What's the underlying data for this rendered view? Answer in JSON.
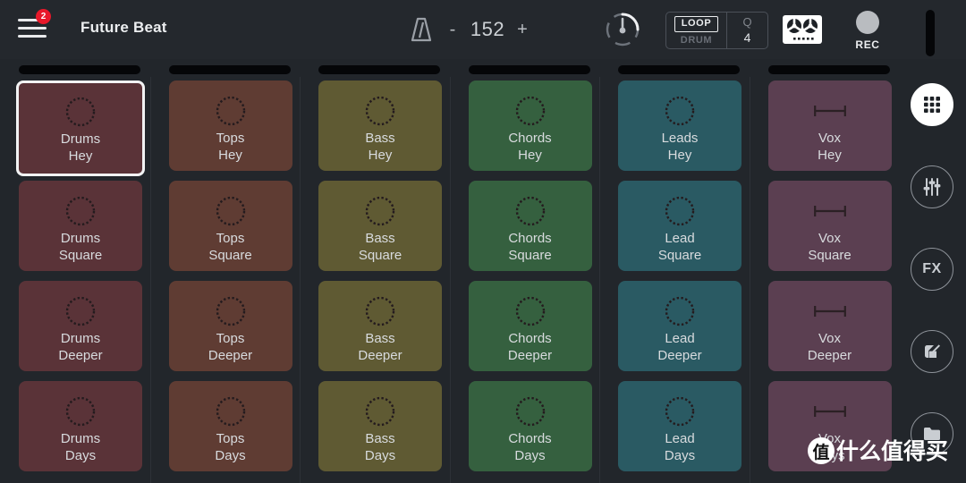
{
  "app": {
    "title": "Future Beat",
    "menu_badge": "2"
  },
  "header": {
    "metronome_icon": "metronome-icon",
    "tempo_decrease": "-",
    "tempo_value": "152",
    "tempo_increase": "+",
    "dial_icon": "dial-knob-icon",
    "loop_label": "LOOP",
    "drum_label": "DRUM",
    "quantize_label": "Q",
    "quantize_value": "4",
    "mixer_icon": "mixer-icon",
    "rec_label": "REC",
    "rec_icon": "record-dot-icon",
    "scrollbar": "vertical-scrollbar"
  },
  "rail": {
    "items": [
      {
        "name": "grid-view-button",
        "icon": "grid-icon",
        "active": true
      },
      {
        "name": "mixer-faders-button",
        "icon": "faders-icon",
        "active": false
      },
      {
        "name": "fx-button",
        "icon": "fx-icon",
        "label": "FX",
        "active": false
      },
      {
        "name": "edit-button",
        "icon": "pencil-edit-icon",
        "active": false
      },
      {
        "name": "files-button",
        "icon": "folder-icon",
        "active": false
      }
    ]
  },
  "grid": {
    "columns": [
      {
        "track": "Drums",
        "color": "#5a3338",
        "icon": "dotted-circle-icon",
        "cells": [
          {
            "name": "Drums",
            "clip": "Hey",
            "selected": true
          },
          {
            "name": "Drums",
            "clip": "Square",
            "selected": false
          },
          {
            "name": "Drums",
            "clip": "Deeper",
            "selected": false
          },
          {
            "name": "Drums",
            "clip": "Days",
            "selected": false
          }
        ]
      },
      {
        "track": "Tops",
        "color": "#5f3c33",
        "icon": "dotted-circle-icon",
        "cells": [
          {
            "name": "Tops",
            "clip": "Hey",
            "selected": false
          },
          {
            "name": "Tops",
            "clip": "Square",
            "selected": false
          },
          {
            "name": "Tops",
            "clip": "Deeper",
            "selected": false
          },
          {
            "name": "Tops",
            "clip": "Days",
            "selected": false
          }
        ]
      },
      {
        "track": "Bass",
        "color": "#5f5a33",
        "icon": "dotted-circle-icon",
        "cells": [
          {
            "name": "Bass",
            "clip": "Hey",
            "selected": false
          },
          {
            "name": "Bass",
            "clip": "Square",
            "selected": false
          },
          {
            "name": "Bass",
            "clip": "Deeper",
            "selected": false
          },
          {
            "name": "Bass",
            "clip": "Days",
            "selected": false
          }
        ]
      },
      {
        "track": "Chords",
        "color": "#35603f",
        "icon": "dotted-circle-icon",
        "cells": [
          {
            "name": "Chords",
            "clip": "Hey",
            "selected": false
          },
          {
            "name": "Chords",
            "clip": "Square",
            "selected": false
          },
          {
            "name": "Chords",
            "clip": "Deeper",
            "selected": false
          },
          {
            "name": "Chords",
            "clip": "Days",
            "selected": false
          }
        ]
      },
      {
        "track": "Leads",
        "color": "#2a5a63",
        "icon": "dotted-circle-icon",
        "cells": [
          {
            "name": "Leads",
            "clip": "Hey",
            "selected": false
          },
          {
            "name": "Lead",
            "clip": "Square",
            "selected": false
          },
          {
            "name": "Lead",
            "clip": "Deeper",
            "selected": false
          },
          {
            "name": "Lead",
            "clip": "Days",
            "selected": false
          }
        ]
      },
      {
        "track": "Vox",
        "color": "#5b3f51",
        "icon": "audio-bar-icon",
        "cells": [
          {
            "name": "Vox",
            "clip": "Hey",
            "selected": false
          },
          {
            "name": "Vox",
            "clip": "Square",
            "selected": false
          },
          {
            "name": "Vox",
            "clip": "Deeper",
            "selected": false
          },
          {
            "name": "Vox",
            "clip": "Days",
            "selected": false
          }
        ]
      }
    ]
  },
  "watermark": {
    "logo": "值",
    "text": "什么值得买"
  }
}
